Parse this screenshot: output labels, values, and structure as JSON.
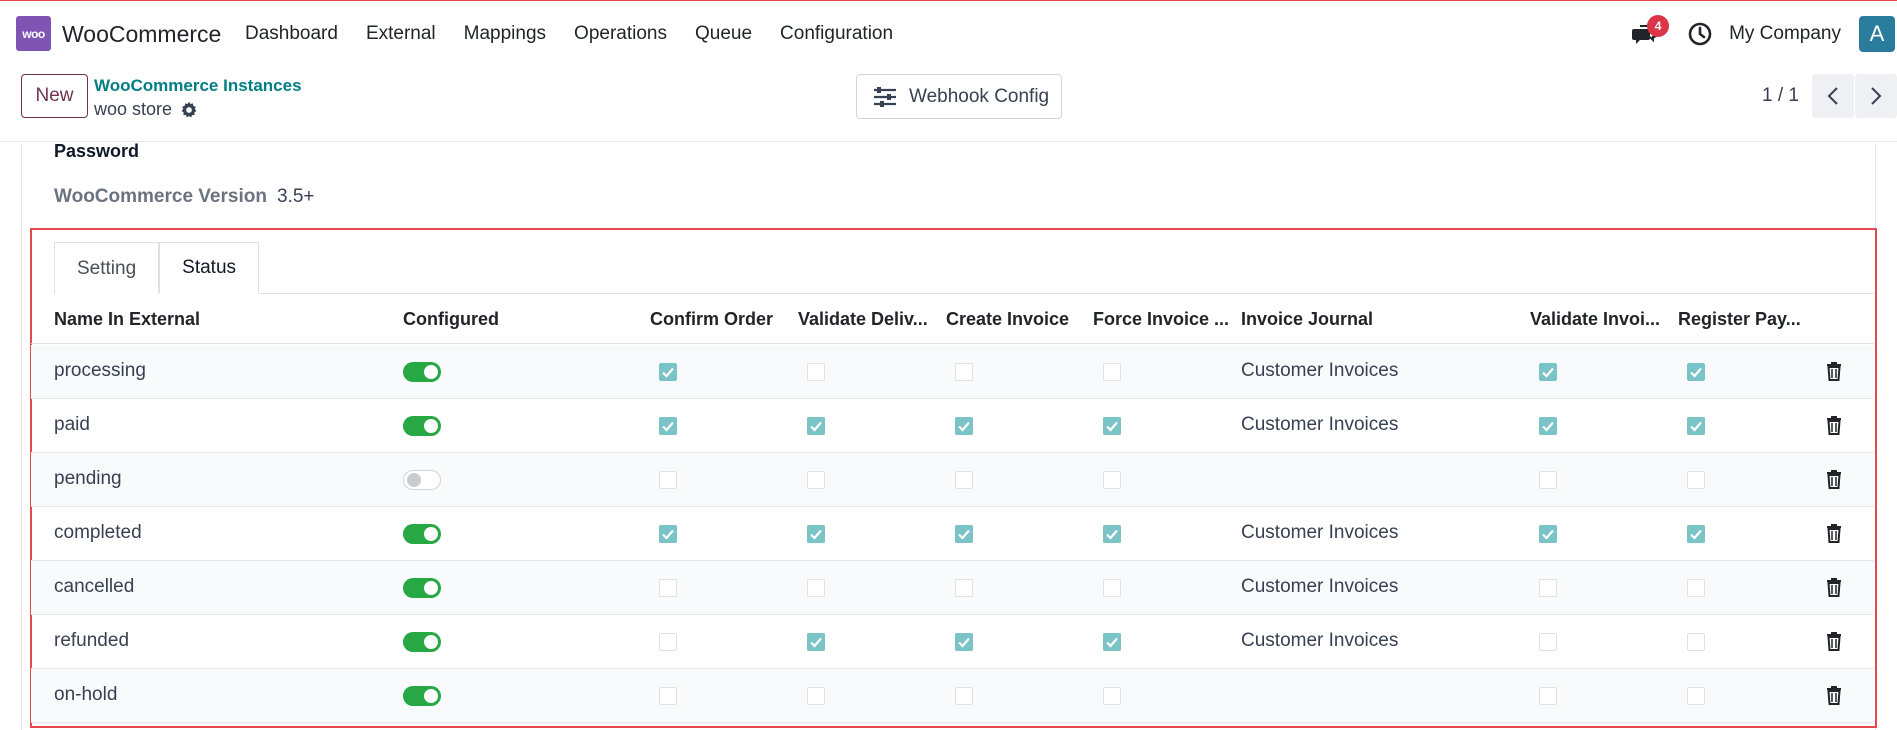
{
  "navbar": {
    "logo_text": "woo",
    "app_name": "WooCommerce",
    "menu": [
      "Dashboard",
      "External",
      "Mappings",
      "Operations",
      "Queue",
      "Configuration"
    ],
    "chat_badge": "4",
    "company": "My Company",
    "avatar_letter": "A",
    "colors": {
      "logo": "#7f54b3",
      "badge": "#dc3545",
      "avatar": "#2a7c9c"
    }
  },
  "control_panel": {
    "new_label": "New",
    "breadcrumb_parent": "WooCommerce Instances",
    "breadcrumb_current": "woo store",
    "webhook_label": "Webhook Config",
    "pager": "1 / 1"
  },
  "form": {
    "password_label": "Password",
    "version_label": "WooCommerce Version",
    "version_value": "3.5+"
  },
  "tabs": [
    {
      "label": "Setting",
      "active": false
    },
    {
      "label": "Status",
      "active": true
    }
  ],
  "table": {
    "columns": [
      "Name In External",
      "Configured",
      "Confirm Order",
      "Validate Deliv...",
      "Create Invoice",
      "Force Invoice ...",
      "Invoice Journal",
      "Validate Invoi...",
      "Register Pay..."
    ],
    "rows": [
      {
        "name": "processing",
        "configured": true,
        "confirm": true,
        "deliv": false,
        "create": false,
        "force": false,
        "journal": "Customer Invoices",
        "validate": true,
        "register": true
      },
      {
        "name": "paid",
        "configured": true,
        "confirm": true,
        "deliv": true,
        "create": true,
        "force": true,
        "journal": "Customer Invoices",
        "validate": true,
        "register": true
      },
      {
        "name": "pending",
        "configured": false,
        "confirm": false,
        "deliv": false,
        "create": false,
        "force": false,
        "journal": "",
        "validate": false,
        "register": false
      },
      {
        "name": "completed",
        "configured": true,
        "confirm": true,
        "deliv": true,
        "create": true,
        "force": true,
        "journal": "Customer Invoices",
        "validate": true,
        "register": true
      },
      {
        "name": "cancelled",
        "configured": true,
        "confirm": false,
        "deliv": false,
        "create": false,
        "force": false,
        "journal": "Customer Invoices",
        "validate": false,
        "register": false
      },
      {
        "name": "refunded",
        "configured": true,
        "confirm": false,
        "deliv": true,
        "create": true,
        "force": true,
        "journal": "Customer Invoices",
        "validate": false,
        "register": false
      },
      {
        "name": "on-hold",
        "configured": true,
        "confirm": false,
        "deliv": false,
        "create": false,
        "force": false,
        "journal": "",
        "validate": false,
        "register": false
      }
    ]
  }
}
